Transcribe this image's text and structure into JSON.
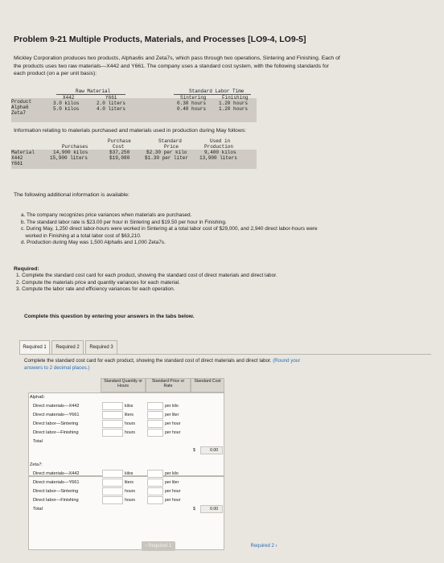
{
  "problem": {
    "title": "Problem 9-21 Multiple Products, Materials, and Processes [LO9-4, LO9-5]",
    "intro_lines": [
      "Mickley Corporation produces two products, Alphas6s and Zeta7s, which pass through two operations, Sintering and Finishing. Each of",
      "the products uses two raw materials—X442 and Y661. The company uses a standard cost system, with the following standards for",
      "each product (on a per unit basis):"
    ]
  },
  "standards_table": {
    "group_raw": "Raw Material",
    "group_labor": "Standard Labor Time",
    "col_product": "Product",
    "col_x442": "X442",
    "col_y661": "Y661",
    "col_sintering": "Sintering",
    "col_finishing": "Finishing",
    "rows": [
      {
        "product": "Alpha6",
        "x442": "3.0 kilos",
        "y661": "2.0 liters",
        "sintering": "0.30 hours",
        "finishing": "1.20 hours"
      },
      {
        "product": "Zeta7",
        "x442": "5.0 kilos",
        "y661": "4.0 liters",
        "sintering": "0.40 hours",
        "finishing": "1.20 hours"
      }
    ]
  },
  "info_heading": "Information relating to materials purchased and materials used in production during May follows:",
  "materials_table": {
    "col_material": "Material",
    "col_purchases": "Purchases",
    "col_cost": "Purchase Cost",
    "col_price": "Standard Price",
    "col_used": "Used in Production",
    "rows": [
      {
        "material": "X442",
        "purchases": "14,900 kilos",
        "cost": "$37,250",
        "price": "$2.30 per kilo",
        "used": "9,400 kilos"
      },
      {
        "material": "Y661",
        "purchases": "15,900 liters",
        "cost": "$19,080",
        "price": "$1.30 per liter",
        "used": "13,900 liters"
      }
    ]
  },
  "additional_heading": "The following additional information is available:",
  "additional": [
    "a. The company recognizes price variances when materials are purchased.",
    "b. The standard labor rate is $23.00 per hour in Sintering and $19.50 per hour in Finishing.",
    "c. During May, 1,250 direct labor-hours were worked in Sintering at a total labor cost of $29,000, and 2,940 direct labor-hours were",
    "   worked in Finishing at a total labor cost of $63,210.",
    "d. Production during May was 1,500 Alpha6s and 1,000 Zeta7s."
  ],
  "required_heading": "Required:",
  "required": [
    "1. Complete the standard cost card for each product, showing the standard cost of direct materials and direct labor.",
    "2. Compute the materials price and quantity variances for each material.",
    "3. Compute the labor rate and efficiency variances for each operation."
  ],
  "complete_instruction": "Complete this question by entering your answers in the tabs below.",
  "tabs": [
    "Required 1",
    "Required 2",
    "Required 3"
  ],
  "panel_instruction": "Complete the standard cost card for each product, showing the standard cost of direct materials and direct labor.",
  "panel_round": "(Round your answers to 2 decimal places.)",
  "panel_round_wrap": "answers to 2 decimal places.)",
  "card": {
    "col_qty": "Standard Quantity or Hours",
    "col_price": "Standard Price or Rate",
    "col_cost": "Standard Cost",
    "alpha_label": "Alpha6:",
    "zeta_label": "Zeta7:",
    "alpha_rows": [
      {
        "label": "Direct materials—X442",
        "unit": "kilos",
        "rate_unit": "per kilo"
      },
      {
        "label": "Direct materials—Y661",
        "unit": "liters",
        "rate_unit": "per liter"
      },
      {
        "label": "Direct labor—Sintering",
        "unit": "hours",
        "rate_unit": "per hour"
      },
      {
        "label": "Direct labor—Finishing",
        "unit": "hours",
        "rate_unit": "per hour"
      }
    ],
    "zeta_rows": [
      {
        "label": "Direct materials—X442",
        "unit": "kilos",
        "rate_unit": "per kilo"
      },
      {
        "label": "Direct materials—Y661",
        "unit": "liters",
        "rate_unit": "per liter"
      },
      {
        "label": "Direct labor—Sintering",
        "unit": "hours",
        "rate_unit": "per hour"
      },
      {
        "label": "Direct labor—Finishing",
        "unit": "hours",
        "rate_unit": "per hour"
      }
    ],
    "total_label": "Total",
    "currency": "$",
    "alpha_total": "0.00",
    "zeta_total": "0.00"
  },
  "nav": {
    "prev": "Required 1",
    "next": "Required 2"
  }
}
